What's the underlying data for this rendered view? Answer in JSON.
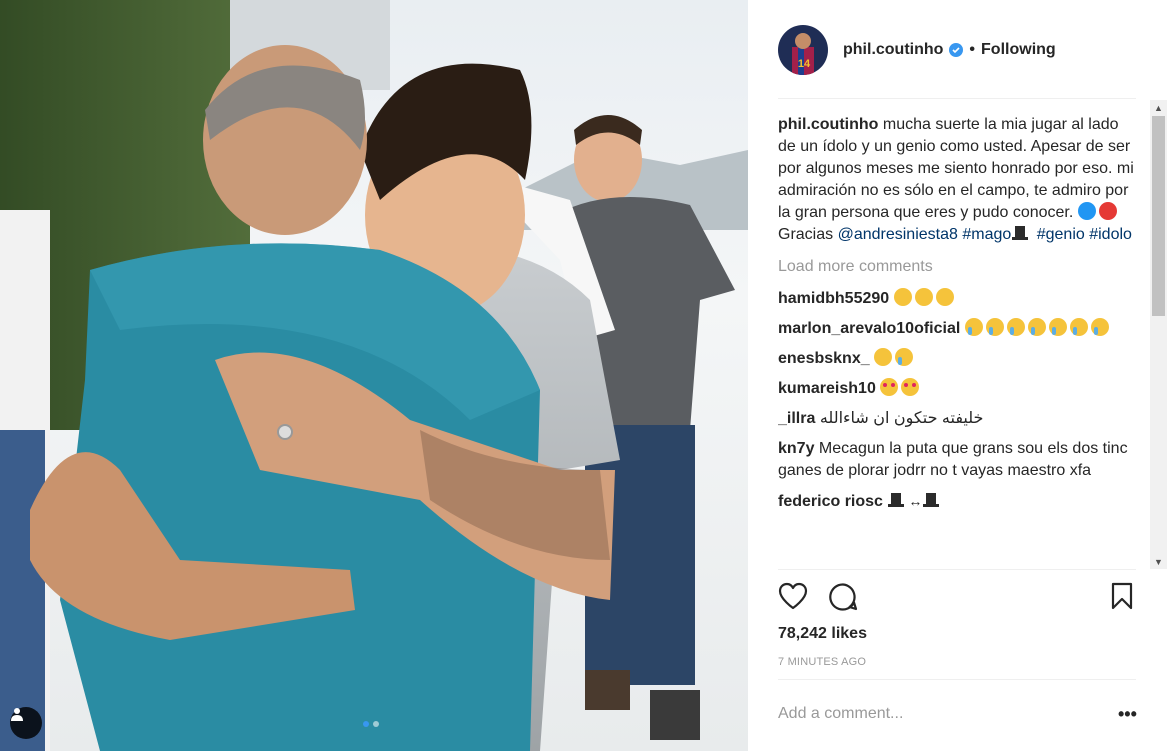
{
  "header": {
    "username": "phil.coutinho",
    "separator": "•",
    "follow_status": "Following"
  },
  "caption": {
    "username": "phil.coutinho",
    "text": "mucha suerte la mia jugar al lado de un ídolo y un genio como usted. Apesar de ser por algunos meses me siento honrado por eso. mi admiración no es sólo en el campo, te admiro por la gran persona que eres y pudo conocer.",
    "emojis": [
      "blue-circle",
      "red-circle"
    ],
    "thanks": "Gracias",
    "mention": "@andresiniesta8",
    "hashtag1": "#mago",
    "hat_emoji": "top-hat",
    "hashtag2": "#genio",
    "hashtag3": "#idolo"
  },
  "load_more": "Load more comments",
  "comments": [
    {
      "username": "hamidbh55290",
      "text": "",
      "emojis": [
        "weary-face",
        "weary-face",
        "weary-face"
      ]
    },
    {
      "username": "marlon_arevalo10oficial",
      "text": "",
      "emojis": [
        "crying-face",
        "crying-face",
        "crying-face",
        "crying-face",
        "crying-face",
        "crying-face",
        "crying-face"
      ]
    },
    {
      "username": "enesbsknx_",
      "text": "",
      "emojis": [
        "confounded-face",
        "crying-face"
      ]
    },
    {
      "username": "kumareish10",
      "text": "",
      "emojis": [
        "heart-eyes",
        "heart-eyes"
      ]
    },
    {
      "username": "_illra",
      "text": "خليفته حتكون ان شاءالله",
      "emojis": []
    },
    {
      "username": "kn7y",
      "text": "Mecagun la puta que grans sou els dos tinc ganes de plorar jodrr no t vayas maestro xfa",
      "emojis": []
    },
    {
      "username": "federico riosc",
      "text": "↔",
      "emojis": [
        "top-hat",
        "top-hat"
      ]
    }
  ],
  "actions": {
    "like_icon": "heart-icon",
    "comment_icon": "comment-icon",
    "save_icon": "bookmark-icon"
  },
  "likes": "78,242 likes",
  "timestamp": "7 MINUTES AGO",
  "add_comment_placeholder": "Add a comment...",
  "more_options": "•••",
  "carousel": {
    "count": 2,
    "active": 1
  },
  "colors": {
    "link": "#003569",
    "verified": "#3897f0",
    "muted": "#999999",
    "text": "#262626"
  }
}
